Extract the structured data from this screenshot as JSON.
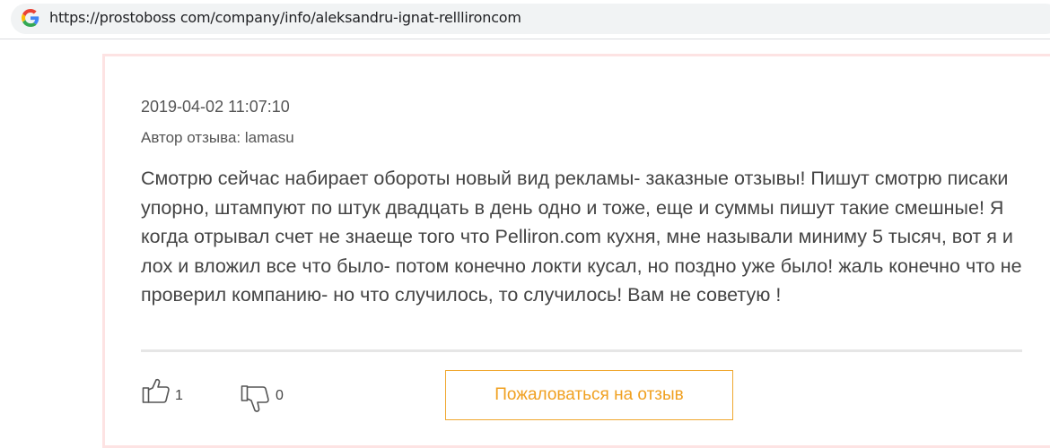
{
  "browser": {
    "url": "https://prostoboss com/company/info/aleksandru-ignat-relllironcom"
  },
  "review": {
    "date": "2019-04-02 11:07:10",
    "author": "Автор отзыва: lamasu",
    "text": "Смотрю сейчас набирает обороты новый вид рекламы- заказные отзывы! Пишут смотрю писаки упорно, штампуют по штук двадцать в день одно и тоже, еще и суммы пишут такие смешные! Я когда отрывал счет не знаеще того что Pelliron.com кухня, мне называли миниму 5 тысяч, вот я и лох и вложил все что было- потом конечно локти кусал, но поздно уже было! жаль конечно что не проверил компанию- но что случилось, то случилось! Вам не советую !",
    "likes": "1",
    "dislikes": "0",
    "complain_label": "Пожаловаться на отзыв"
  },
  "colors": {
    "accent": "#f0a020",
    "card_border": "#fde3e3"
  },
  "icons": {
    "browser": "google-g-icon",
    "like": "thumbs-up-icon",
    "dislike": "thumbs-down-icon"
  }
}
